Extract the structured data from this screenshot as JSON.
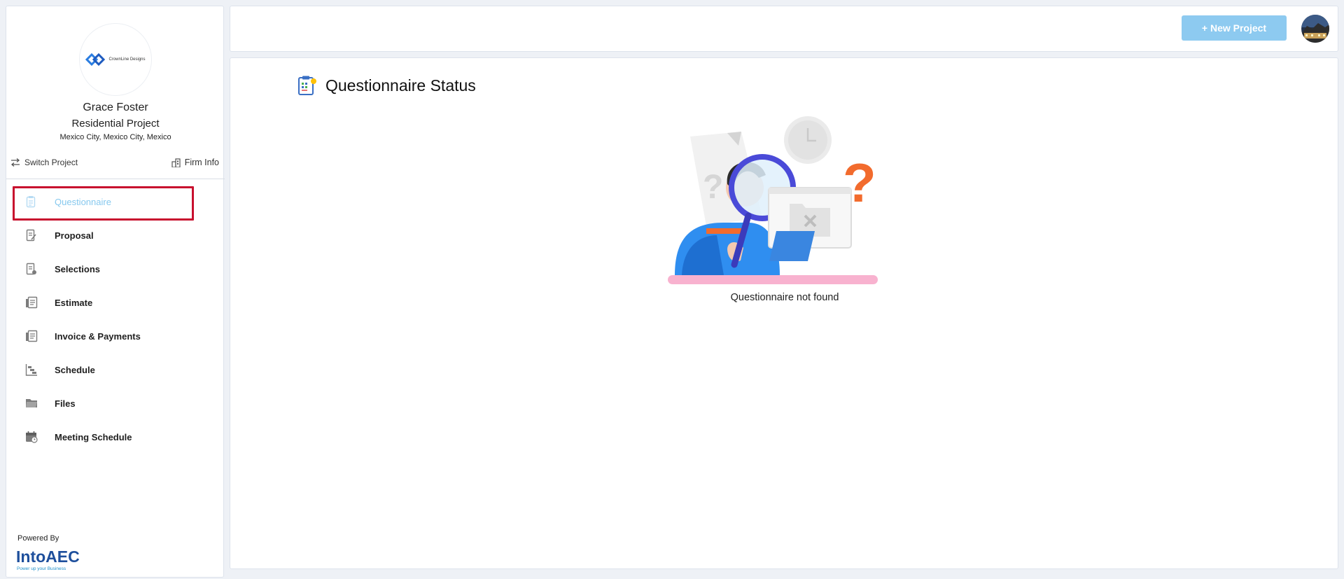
{
  "sidebar": {
    "logo_text": "CrownLine Designs",
    "client_name": "Grace Foster",
    "project_type": "Residential Project",
    "location": "Mexico City, Mexico City, Mexico",
    "switch_project": "Switch Project",
    "firm_info": "Firm Info",
    "items": [
      {
        "label": "Questionnaire",
        "icon": "questionnaire-icon",
        "active": true
      },
      {
        "label": "Proposal",
        "icon": "proposal-icon"
      },
      {
        "label": "Selections",
        "icon": "selections-icon"
      },
      {
        "label": "Estimate",
        "icon": "estimate-icon"
      },
      {
        "label": "Invoice & Payments",
        "icon": "invoice-icon"
      },
      {
        "label": "Schedule",
        "icon": "schedule-icon"
      },
      {
        "label": "Files",
        "icon": "folder-icon"
      },
      {
        "label": "Meeting Schedule",
        "icon": "calendar-icon"
      }
    ],
    "powered_by": "Powered By",
    "brand_name": "IntoAEC",
    "brand_tagline": "Power up your Business"
  },
  "header": {
    "new_project_label": "+ New Project"
  },
  "main": {
    "title": "Questionnaire Status",
    "empty_message": "Questionnaire not found"
  },
  "colors": {
    "accent": "#8dcaf0",
    "active_nav": "#86c8ee",
    "highlight": "#c8102e"
  }
}
